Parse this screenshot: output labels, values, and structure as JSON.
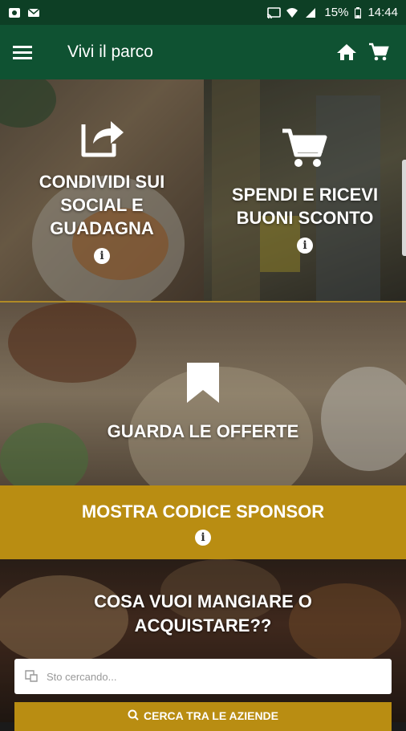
{
  "statusbar": {
    "battery": "15%",
    "time": "14:44"
  },
  "appbar": {
    "title": "Vivi il parco",
    "menu_icon": "menu-icon",
    "home_icon": "home-icon",
    "cart_icon": "cart-icon"
  },
  "tiles": {
    "share": {
      "label": "CONDIVIDI SUI SOCIAL E GUADAGNA",
      "icon": "share-icon",
      "info": "i"
    },
    "spend": {
      "label": "SPENDI E RICEVI BUONI SCONTO",
      "icon": "cart-icon",
      "info": "i"
    },
    "offers": {
      "label": "GUARDA LE OFFERTE",
      "icon": "bookmark-icon"
    }
  },
  "sponsor": {
    "label": "MOSTRA CODICE SPONSOR",
    "info": "i"
  },
  "search": {
    "question": "COSA VUOI MANGIARE O ACQUISTARE??",
    "placeholder": "Sto cercando...",
    "button_label": "CERCA TRA LE AZIENDE"
  },
  "colors": {
    "status_bar": "#0d3f25",
    "app_bar": "#0f5232",
    "accent_gold": "#b98d12"
  }
}
